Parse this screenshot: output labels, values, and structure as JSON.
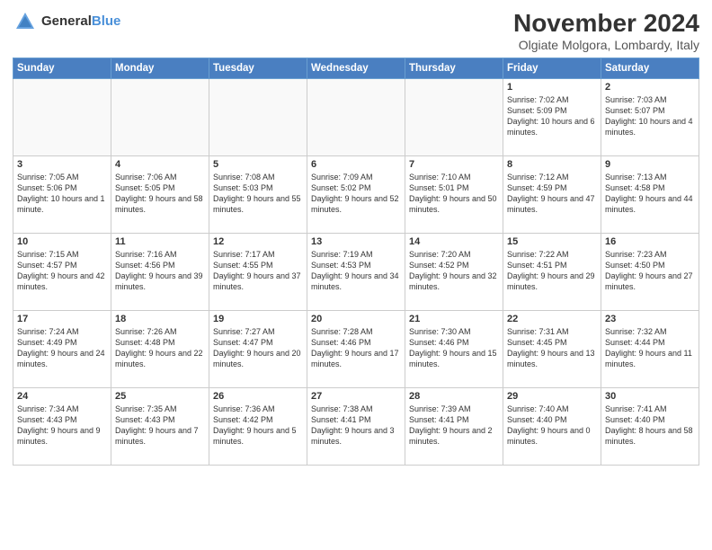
{
  "header": {
    "logo_general": "General",
    "logo_blue": "Blue",
    "title": "November 2024",
    "location": "Olgiate Molgora, Lombardy, Italy"
  },
  "columns": [
    "Sunday",
    "Monday",
    "Tuesday",
    "Wednesday",
    "Thursday",
    "Friday",
    "Saturday"
  ],
  "weeks": [
    [
      {
        "day": "",
        "info": ""
      },
      {
        "day": "",
        "info": ""
      },
      {
        "day": "",
        "info": ""
      },
      {
        "day": "",
        "info": ""
      },
      {
        "day": "",
        "info": ""
      },
      {
        "day": "1",
        "info": "Sunrise: 7:02 AM\nSunset: 5:09 PM\nDaylight: 10 hours and 6 minutes."
      },
      {
        "day": "2",
        "info": "Sunrise: 7:03 AM\nSunset: 5:07 PM\nDaylight: 10 hours and 4 minutes."
      }
    ],
    [
      {
        "day": "3",
        "info": "Sunrise: 7:05 AM\nSunset: 5:06 PM\nDaylight: 10 hours and 1 minute."
      },
      {
        "day": "4",
        "info": "Sunrise: 7:06 AM\nSunset: 5:05 PM\nDaylight: 9 hours and 58 minutes."
      },
      {
        "day": "5",
        "info": "Sunrise: 7:08 AM\nSunset: 5:03 PM\nDaylight: 9 hours and 55 minutes."
      },
      {
        "day": "6",
        "info": "Sunrise: 7:09 AM\nSunset: 5:02 PM\nDaylight: 9 hours and 52 minutes."
      },
      {
        "day": "7",
        "info": "Sunrise: 7:10 AM\nSunset: 5:01 PM\nDaylight: 9 hours and 50 minutes."
      },
      {
        "day": "8",
        "info": "Sunrise: 7:12 AM\nSunset: 4:59 PM\nDaylight: 9 hours and 47 minutes."
      },
      {
        "day": "9",
        "info": "Sunrise: 7:13 AM\nSunset: 4:58 PM\nDaylight: 9 hours and 44 minutes."
      }
    ],
    [
      {
        "day": "10",
        "info": "Sunrise: 7:15 AM\nSunset: 4:57 PM\nDaylight: 9 hours and 42 minutes."
      },
      {
        "day": "11",
        "info": "Sunrise: 7:16 AM\nSunset: 4:56 PM\nDaylight: 9 hours and 39 minutes."
      },
      {
        "day": "12",
        "info": "Sunrise: 7:17 AM\nSunset: 4:55 PM\nDaylight: 9 hours and 37 minutes."
      },
      {
        "day": "13",
        "info": "Sunrise: 7:19 AM\nSunset: 4:53 PM\nDaylight: 9 hours and 34 minutes."
      },
      {
        "day": "14",
        "info": "Sunrise: 7:20 AM\nSunset: 4:52 PM\nDaylight: 9 hours and 32 minutes."
      },
      {
        "day": "15",
        "info": "Sunrise: 7:22 AM\nSunset: 4:51 PM\nDaylight: 9 hours and 29 minutes."
      },
      {
        "day": "16",
        "info": "Sunrise: 7:23 AM\nSunset: 4:50 PM\nDaylight: 9 hours and 27 minutes."
      }
    ],
    [
      {
        "day": "17",
        "info": "Sunrise: 7:24 AM\nSunset: 4:49 PM\nDaylight: 9 hours and 24 minutes."
      },
      {
        "day": "18",
        "info": "Sunrise: 7:26 AM\nSunset: 4:48 PM\nDaylight: 9 hours and 22 minutes."
      },
      {
        "day": "19",
        "info": "Sunrise: 7:27 AM\nSunset: 4:47 PM\nDaylight: 9 hours and 20 minutes."
      },
      {
        "day": "20",
        "info": "Sunrise: 7:28 AM\nSunset: 4:46 PM\nDaylight: 9 hours and 17 minutes."
      },
      {
        "day": "21",
        "info": "Sunrise: 7:30 AM\nSunset: 4:46 PM\nDaylight: 9 hours and 15 minutes."
      },
      {
        "day": "22",
        "info": "Sunrise: 7:31 AM\nSunset: 4:45 PM\nDaylight: 9 hours and 13 minutes."
      },
      {
        "day": "23",
        "info": "Sunrise: 7:32 AM\nSunset: 4:44 PM\nDaylight: 9 hours and 11 minutes."
      }
    ],
    [
      {
        "day": "24",
        "info": "Sunrise: 7:34 AM\nSunset: 4:43 PM\nDaylight: 9 hours and 9 minutes."
      },
      {
        "day": "25",
        "info": "Sunrise: 7:35 AM\nSunset: 4:43 PM\nDaylight: 9 hours and 7 minutes."
      },
      {
        "day": "26",
        "info": "Sunrise: 7:36 AM\nSunset: 4:42 PM\nDaylight: 9 hours and 5 minutes."
      },
      {
        "day": "27",
        "info": "Sunrise: 7:38 AM\nSunset: 4:41 PM\nDaylight: 9 hours and 3 minutes."
      },
      {
        "day": "28",
        "info": "Sunrise: 7:39 AM\nSunset: 4:41 PM\nDaylight: 9 hours and 2 minutes."
      },
      {
        "day": "29",
        "info": "Sunrise: 7:40 AM\nSunset: 4:40 PM\nDaylight: 9 hours and 0 minutes."
      },
      {
        "day": "30",
        "info": "Sunrise: 7:41 AM\nSunset: 4:40 PM\nDaylight: 8 hours and 58 minutes."
      }
    ]
  ]
}
